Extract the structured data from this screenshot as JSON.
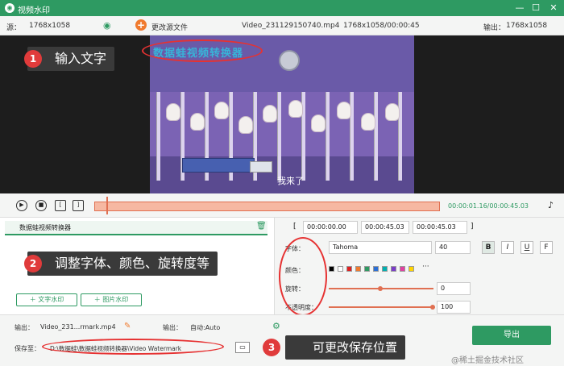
{
  "app": {
    "title": "视频水印",
    "minimize": "—",
    "maximize": "☐",
    "close": "✕"
  },
  "info": {
    "source_label": "源：",
    "source_res": "1768x1058",
    "change_source": "更改源文件",
    "filename": "Video_231129150740.mp4",
    "file_res": "1768x1058/00:00:45",
    "output_label": "输出：",
    "output_res": "1768x1058"
  },
  "preview": {
    "watermark_text": "数据蛙视频转换器",
    "caption": "我来了"
  },
  "callouts": [
    {
      "num": "1",
      "text": "输入文字"
    },
    {
      "num": "2",
      "text": "调整字体、颜色、旋转度等"
    },
    {
      "num": "3",
      "text": "可更改保存位置"
    }
  ],
  "playback": {
    "time": "00:00:01.16/00:00:45.03"
  },
  "layer": {
    "name": "数据蛙视频转换器"
  },
  "buttons": {
    "add_text": "文字水印",
    "add_image": "图片水印",
    "export": "导出"
  },
  "range": {
    "start": "00:00:00.00",
    "mid": "00:00:45.03",
    "end": "00:00:45.03"
  },
  "props": {
    "font_label": "字体：",
    "font": "Tahoma",
    "size": "40",
    "color_label": "颜色：",
    "rotate_label": "旋转：",
    "rotate": "0",
    "opacity_label": "不透明度：",
    "opacity": "100",
    "bold": "B",
    "italic": "I",
    "underline": "U",
    "strike": "F"
  },
  "colors": [
    "#000000",
    "#ffffff",
    "#e02020",
    "#f07a2e",
    "#2e9a62",
    "#2a6fd6",
    "#00b0b0",
    "#7a3cc8",
    "#e040a0",
    "#ffd400"
  ],
  "output": {
    "label": "输出：",
    "file": "Video_231...rmark.mp4",
    "format_label": "输出：",
    "format": "自动:Auto"
  },
  "save": {
    "label": "保存至：",
    "path": "D:\\数据蛙\\数据蛙视频转换器\\Video Watermark"
  },
  "corner_mark": "@稀土掘金技术社区"
}
